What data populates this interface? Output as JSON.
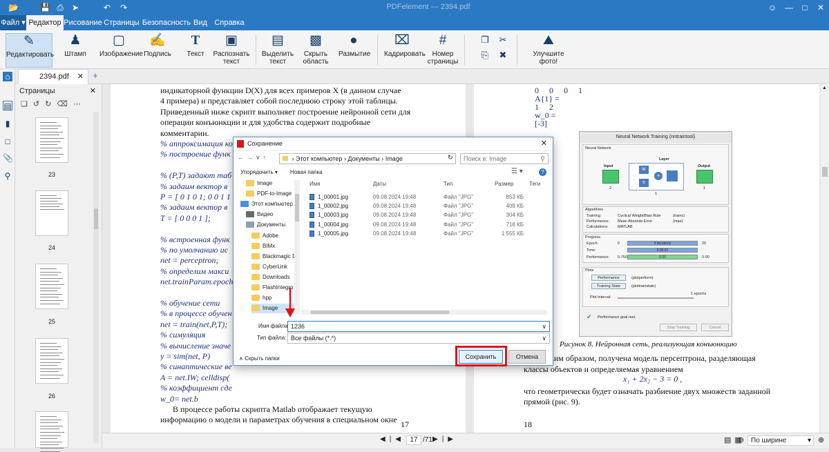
{
  "app": {
    "title": "PDFelement — 2394.pdf",
    "file_label": "Файл"
  },
  "menu_tabs": [
    "Редактор",
    "Рисование",
    "Страницы",
    "Безопасность",
    "Вид",
    "Справка"
  ],
  "ribbon": [
    "Редактировать",
    "Штамп",
    "Изображение",
    "Подпись",
    "Текст",
    "Распознать текст",
    "Выделить текст",
    "Скрыть область",
    "Размытие",
    "Кадрировать",
    "Номер страницы",
    "Улучшите фото!"
  ],
  "doc_tab": "2394.pdf",
  "pages_panel": {
    "title": "Страницы",
    "thumbs": [
      "23",
      "24",
      "25",
      "26"
    ]
  },
  "page_left": {
    "lines": [
      {
        "t": "индикаторной функции D(X) для всех примеров X (в данном случае",
        "s": "n"
      },
      {
        "t": "4 примера) и представляет собой последнюю строку этой таблицы.",
        "s": "n"
      },
      {
        "t": "Приведенный ниже скрипт выполняет построение нейронной сети для",
        "s": "n"
      },
      {
        "t": "операции конъюнкции и для удобства содержит подробные",
        "s": "n"
      },
      {
        "t": "комментарии.",
        "s": "n"
      },
      {
        "t": "% аппроксимация ко",
        "s": "i"
      },
      {
        "t": "% построение функ",
        "s": "i"
      },
      {
        "t": "",
        "s": "n"
      },
      {
        "t": "% (P,T) задают таб",
        "s": "i"
      },
      {
        "t": "% задаим вектор в",
        "s": "i"
      },
      {
        "t": "P = [ 0 1 0 1; 0 0 1 1",
        "s": "i"
      },
      {
        "t": "% задаим вектор в",
        "s": "i"
      },
      {
        "t": "T = [ 0 0 0 1 ];",
        "s": "i"
      },
      {
        "t": "",
        "s": "n"
      },
      {
        "t": "% встроенная функ",
        "s": "i"
      },
      {
        "t": "% по умолчанию ис",
        "s": "i"
      },
      {
        "t": "net = perceptron;",
        "s": "i"
      },
      {
        "t": "% определим макси",
        "s": "i"
      },
      {
        "t": "net.trainParam.epoch",
        "s": "i"
      },
      {
        "t": "",
        "s": "n"
      },
      {
        "t": "% обучение сети",
        "s": "i"
      },
      {
        "t": "% в процессе обучен",
        "s": "i"
      },
      {
        "t": "net = train(net,P,T);",
        "s": "i"
      },
      {
        "t": "% симуляция",
        "s": "i"
      },
      {
        "t": "% вычисление значе",
        "s": "i"
      },
      {
        "t": "y = sim(net, P)",
        "s": "i"
      },
      {
        "t": "% синаптические ве",
        "s": "i"
      },
      {
        "t": "A = net.IW; celldisp(",
        "s": "i"
      },
      {
        "t": "% коэффициент сде",
        "s": "i"
      },
      {
        "t": "w_0= net.b",
        "s": "i"
      },
      {
        "t": "      В процессе работы скрипта Matlab отображает текущую",
        "s": "n"
      },
      {
        "t": "информацию о модели и параметрах обучения в специальном окне",
        "s": "n"
      }
    ],
    "page_number": "17"
  },
  "page_right": {
    "top_lines": [
      "0     0     0     1",
      "A{1} =",
      "1     2",
      "w_0 =",
      "[-3]"
    ],
    "figure": {
      "title": "Neural Network Training (nntraintool)",
      "section_network": "Neural Network",
      "layer": "Layer",
      "input": "Input",
      "output": "Output",
      "w": "W",
      "b": "b",
      "input_n": "2",
      "output_n": "1",
      "layer_n": "1",
      "section_algorithms": "Algorithms",
      "alg_rows": [
        [
          "Training:",
          "Cyclical Weight/Bias Rule",
          "(trainc)"
        ],
        [
          "Performance:",
          "Mean Absolute Error",
          "(mae)"
        ],
        [
          "Calculations:",
          "MATLAB",
          ""
        ]
      ],
      "section_progress": "Progress",
      "prog_rows": [
        [
          "Epoch:",
          "0",
          "5 iterations",
          "20"
        ],
        [
          "Time:",
          "",
          "0:00:01",
          ""
        ],
        [
          "Performance:",
          "0.750",
          "0.00",
          "0.00"
        ]
      ],
      "section_plots": "Plots",
      "plot_buttons": [
        [
          "Performance",
          "(plotperform)"
        ],
        [
          "Training State",
          "(plottrainstate)"
        ]
      ],
      "plot_interval_label": "Plot Interval:",
      "plot_interval_value": "1 epochs",
      "goal": "Performance goal met.",
      "stop": "Stop Training",
      "cancel": "Cancel"
    },
    "caption": "Рисунок 8. Нейронная сеть, реализующая конъюнкцию",
    "body_lines": [
      "ким образом, получена модель персептрона, разделяющая",
      "классы объектов и определяемая уравнением",
      "x₁ + 2x₂ − 3 = 0 ,",
      "что геометрически будет означать разбиение двух множеств заданной",
      "прямой (рис. 9)."
    ],
    "page_number": "18"
  },
  "dialog": {
    "title": "Сохранение",
    "breadcrumb": [
      "Этот компьютер",
      "Документы",
      "Image"
    ],
    "search_placeholder": "Поиск в: Image",
    "organize": "Упорядочить ▾",
    "new_folder": "Новая папка",
    "nav_items": [
      {
        "label": "Image",
        "indent": 0,
        "icon": "folder"
      },
      {
        "label": "PDF-to-Image",
        "indent": 0,
        "icon": "folder"
      },
      {
        "label": "Этот компьютер",
        "indent": -1,
        "icon": "computer"
      },
      {
        "label": "Видео",
        "indent": 0,
        "icon": "video"
      },
      {
        "label": "Документы",
        "indent": 0,
        "icon": "docs"
      },
      {
        "label": "Adobe",
        "indent": 1,
        "icon": "folder"
      },
      {
        "label": "BIMx",
        "indent": 1,
        "icon": "folder"
      },
      {
        "label": "Blackmagic De",
        "indent": 1,
        "icon": "folder"
      },
      {
        "label": "CyberLink",
        "indent": 1,
        "icon": "folder"
      },
      {
        "label": "Downloads",
        "indent": 1,
        "icon": "folder"
      },
      {
        "label": "FlashIntegro",
        "indent": 1,
        "icon": "folder"
      },
      {
        "label": "hpp",
        "indent": 1,
        "icon": "folder"
      },
      {
        "label": "Image",
        "indent": 1,
        "icon": "folder"
      }
    ],
    "columns": [
      "Имя",
      "Даты",
      "Тип",
      "Размер",
      "Теги"
    ],
    "files": [
      [
        "1_00001.jpg",
        "09.08.2024 19:48",
        "Файл \"JPG\"",
        "853 КБ"
      ],
      [
        "1_00002.jpg",
        "09.08.2024 19:48",
        "Файл \"JPG\"",
        "409 КБ"
      ],
      [
        "1_00003.jpg",
        "09.08.2024 19:48",
        "Файл \"JPG\"",
        "304 КБ"
      ],
      [
        "1_00004.jpg",
        "09.08.2024 19:48",
        "Файл \"JPG\"",
        "716 КБ"
      ],
      [
        "1_00005.jpg",
        "09.08.2024 19:48",
        "Файл \"JPG\"",
        "1 555 КБ"
      ]
    ],
    "filename_label": "Имя файла:",
    "filename_value": "1236",
    "filetype_label": "Тип файла:",
    "filetype_value": "Все файлы (*.*)",
    "hide_folders": "Скрыть папки",
    "save": "Сохранить",
    "cancel": "Отмена"
  },
  "statusbar": {
    "current_page": "17",
    "total": "/71",
    "zoom_mode": "По ширине"
  },
  "colors": {
    "accent": "#2b79c2",
    "highlight": "#e0131a"
  }
}
